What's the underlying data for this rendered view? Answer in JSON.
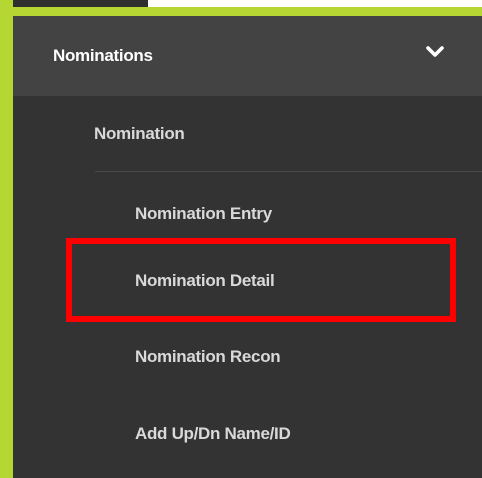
{
  "menu": {
    "header": {
      "title": "Nominations",
      "icon": "chevron-down-icon"
    },
    "section": {
      "label": "Nomination"
    },
    "items": [
      {
        "label": "Nomination Entry"
      },
      {
        "label": "Nomination Detail",
        "highlighted": true
      },
      {
        "label": "Nomination Recon"
      },
      {
        "label": "Add Up/Dn Name/ID"
      }
    ]
  },
  "colors": {
    "accent_border": "#b6d634",
    "menu_background": "#333333",
    "header_background": "#434343",
    "highlight": "#ff0000",
    "text_primary": "#ffffff",
    "text_secondary": "#d9d9d9"
  }
}
